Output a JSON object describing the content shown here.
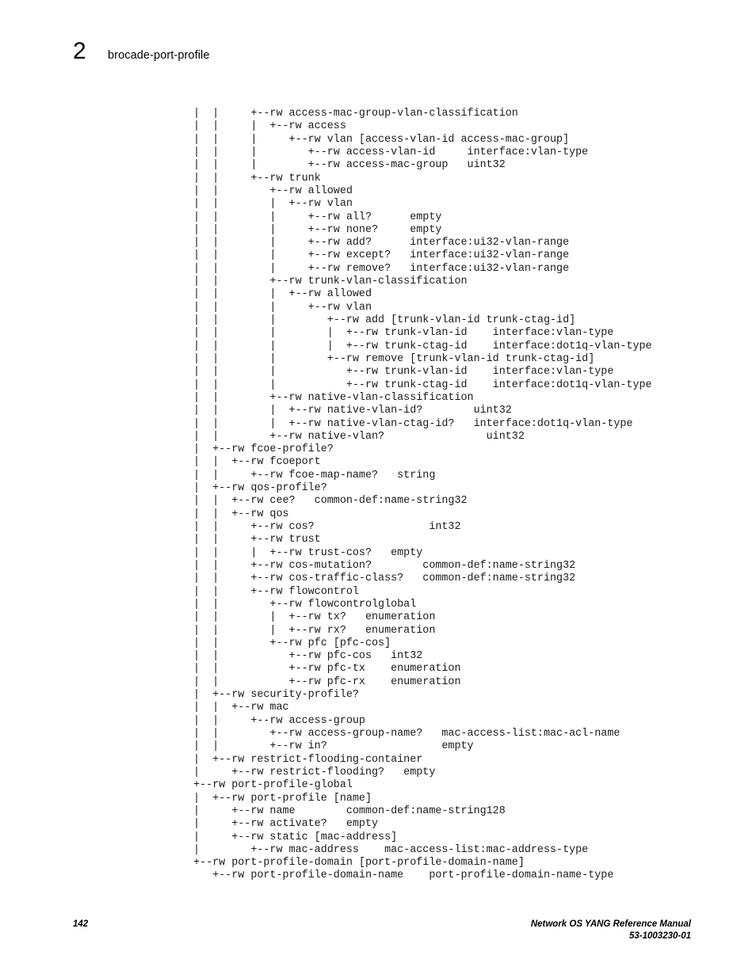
{
  "header": {
    "chapter_number": "2",
    "title": "brocade-port-profile"
  },
  "code_block": {
    "language": "yang-tree",
    "lines": [
      "|  |     +--rw access-mac-group-vlan-classification",
      "|  |     |  +--rw access",
      "|  |     |     +--rw vlan [access-vlan-id access-mac-group]",
      "|  |     |        +--rw access-vlan-id     interface:vlan-type",
      "|  |     |        +--rw access-mac-group   uint32",
      "|  |     +--rw trunk",
      "|  |        +--rw allowed",
      "|  |        |  +--rw vlan",
      "|  |        |     +--rw all?      empty",
      "|  |        |     +--rw none?     empty",
      "|  |        |     +--rw add?      interface:ui32-vlan-range",
      "|  |        |     +--rw except?   interface:ui32-vlan-range",
      "|  |        |     +--rw remove?   interface:ui32-vlan-range",
      "|  |        +--rw trunk-vlan-classification",
      "|  |        |  +--rw allowed",
      "|  |        |     +--rw vlan",
      "|  |        |        +--rw add [trunk-vlan-id trunk-ctag-id]",
      "|  |        |        |  +--rw trunk-vlan-id    interface:vlan-type",
      "|  |        |        |  +--rw trunk-ctag-id    interface:dot1q-vlan-type",
      "|  |        |        +--rw remove [trunk-vlan-id trunk-ctag-id]",
      "|  |        |           +--rw trunk-vlan-id    interface:vlan-type",
      "|  |        |           +--rw trunk-ctag-id    interface:dot1q-vlan-type",
      "|  |        +--rw native-vlan-classification",
      "|  |        |  +--rw native-vlan-id?        uint32",
      "|  |        |  +--rw native-vlan-ctag-id?   interface:dot1q-vlan-type",
      "|  |        +--rw native-vlan?                uint32",
      "|  +--rw fcoe-profile?",
      "|  |  +--rw fcoeport",
      "|  |     +--rw fcoe-map-name?   string",
      "|  +--rw qos-profile?",
      "|  |  +--rw cee?   common-def:name-string32",
      "|  |  +--rw qos",
      "|  |     +--rw cos?                  int32",
      "|  |     +--rw trust",
      "|  |     |  +--rw trust-cos?   empty",
      "|  |     +--rw cos-mutation?        common-def:name-string32",
      "|  |     +--rw cos-traffic-class?   common-def:name-string32",
      "|  |     +--rw flowcontrol",
      "|  |        +--rw flowcontrolglobal",
      "|  |        |  +--rw tx?   enumeration",
      "|  |        |  +--rw rx?   enumeration",
      "|  |        +--rw pfc [pfc-cos]",
      "|  |           +--rw pfc-cos   int32",
      "|  |           +--rw pfc-tx    enumeration",
      "|  |           +--rw pfc-rx    enumeration",
      "|  +--rw security-profile?",
      "|  |  +--rw mac",
      "|  |     +--rw access-group",
      "|  |        +--rw access-group-name?   mac-access-list:mac-acl-name",
      "|  |        +--rw in?                  empty",
      "|  +--rw restrict-flooding-container",
      "|     +--rw restrict-flooding?   empty",
      "+--rw port-profile-global",
      "|  +--rw port-profile [name]",
      "|     +--rw name        common-def:name-string128",
      "|     +--rw activate?   empty",
      "|     +--rw static [mac-address]",
      "|        +--rw mac-address    mac-access-list:mac-address-type",
      "+--rw port-profile-domain [port-profile-domain-name]",
      "   +--rw port-profile-domain-name    port-profile-domain-name-type"
    ]
  },
  "footer": {
    "page_number": "142",
    "manual_title": "Network OS YANG Reference Manual",
    "document_number": "53-1003230-01"
  }
}
